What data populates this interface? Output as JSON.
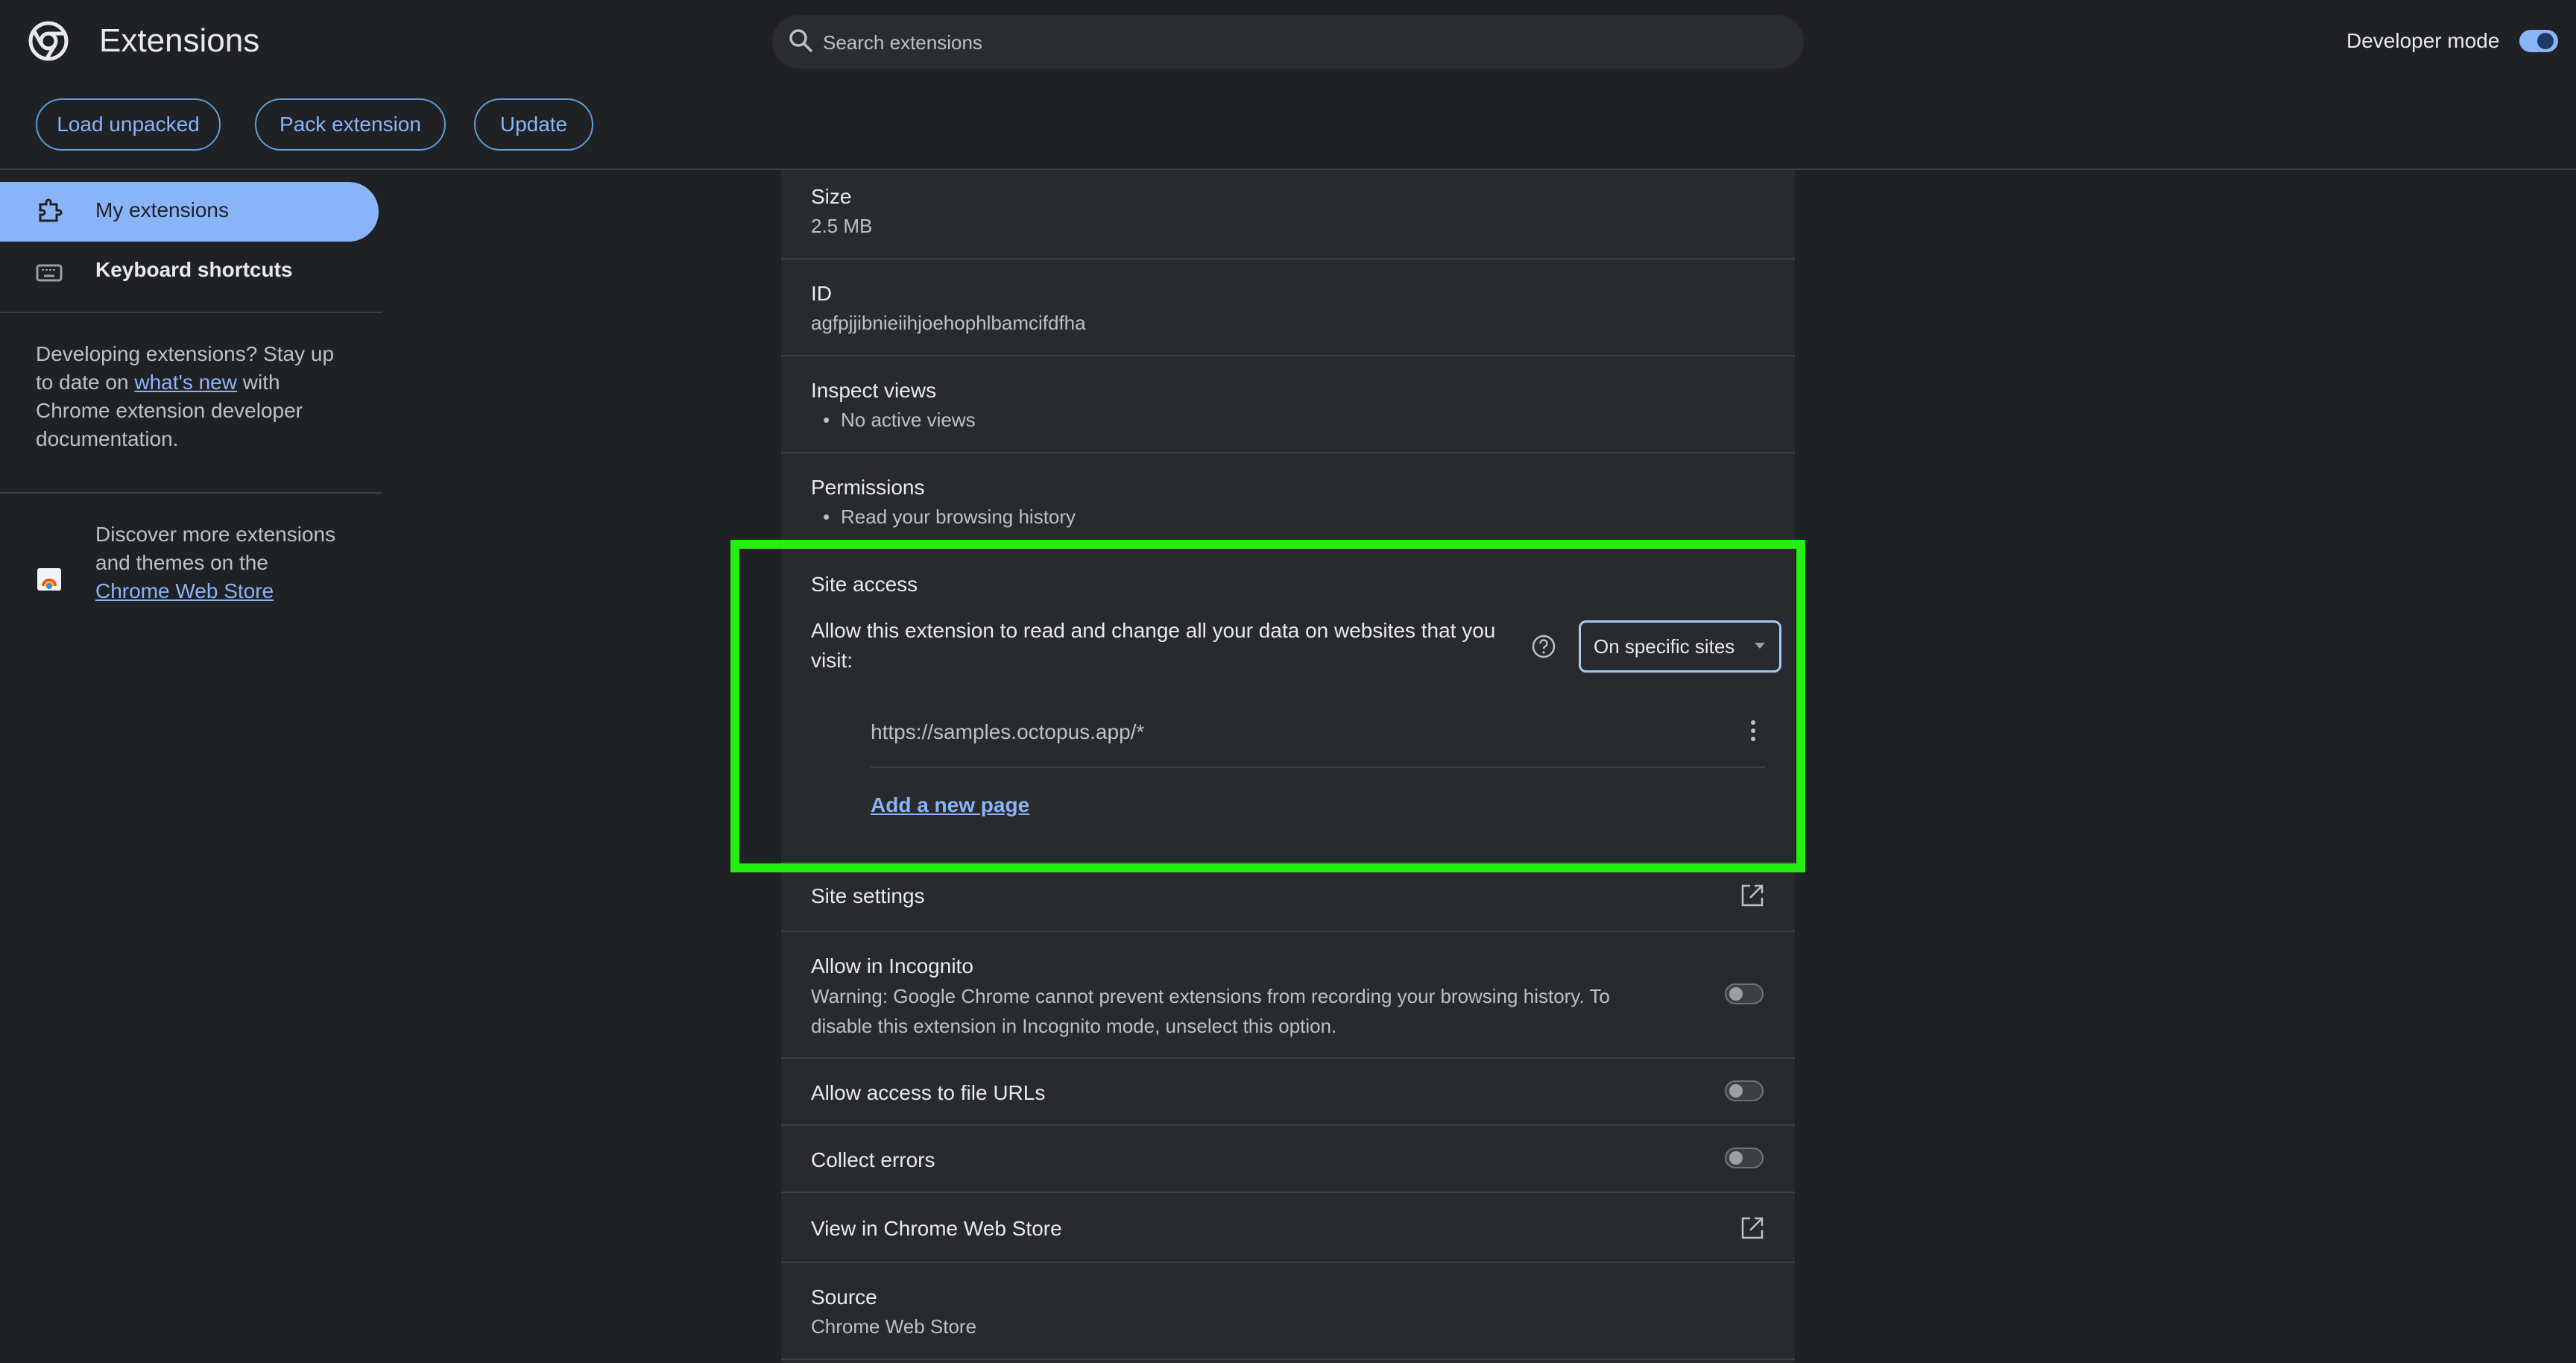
{
  "header": {
    "title": "Extensions",
    "search_placeholder": "Search extensions",
    "developer_mode_label": "Developer mode",
    "developer_mode_on": true
  },
  "toolbar": {
    "load_unpacked": "Load unpacked",
    "pack_extension": "Pack extension",
    "update": "Update"
  },
  "sidebar": {
    "items": [
      {
        "label": "My extensions",
        "icon": "puzzle-icon",
        "selected": true
      },
      {
        "label": "Keyboard shortcuts",
        "icon": "keyboard-icon",
        "selected": false
      }
    ],
    "dev_note": {
      "before": "Developing extensions? Stay up to date on ",
      "link": "what's new",
      "after": " with Chrome extension developer documentation."
    },
    "store_note": {
      "before": "Discover more extensions and themes on the ",
      "link": "Chrome Web Store"
    }
  },
  "details": {
    "size_label": "Size",
    "size_value": "2.5 MB",
    "id_label": "ID",
    "id_value": "agfpjjibnieiihjoehophlbamcifdfha",
    "inspect_label": "Inspect views",
    "inspect_value": "No active views",
    "permissions_label": "Permissions",
    "permissions_value": "Read your browsing history",
    "site_access": {
      "label": "Site access",
      "description": "Allow this extension to read and change all your data on websites that you visit:",
      "selected_option": "On specific sites",
      "sites": [
        "https://samples.octopus.app/*"
      ],
      "add_page": "Add a new page"
    },
    "site_settings_label": "Site settings",
    "incognito_label": "Allow in Incognito",
    "incognito_warning": "Warning: Google Chrome cannot prevent extensions from recording your browsing history. To disable this extension in Incognito mode, unselect this option.",
    "incognito_on": false,
    "file_urls_label": "Allow access to file URLs",
    "file_urls_on": false,
    "collect_errors_label": "Collect errors",
    "collect_errors_on": false,
    "web_store_label": "View in Chrome Web Store",
    "source_label": "Source",
    "source_value": "Chrome Web Store"
  },
  "colors": {
    "accent": "#8ab4f8",
    "highlight_box": "#25ee12",
    "background": "#202124",
    "card": "#292a2d"
  }
}
